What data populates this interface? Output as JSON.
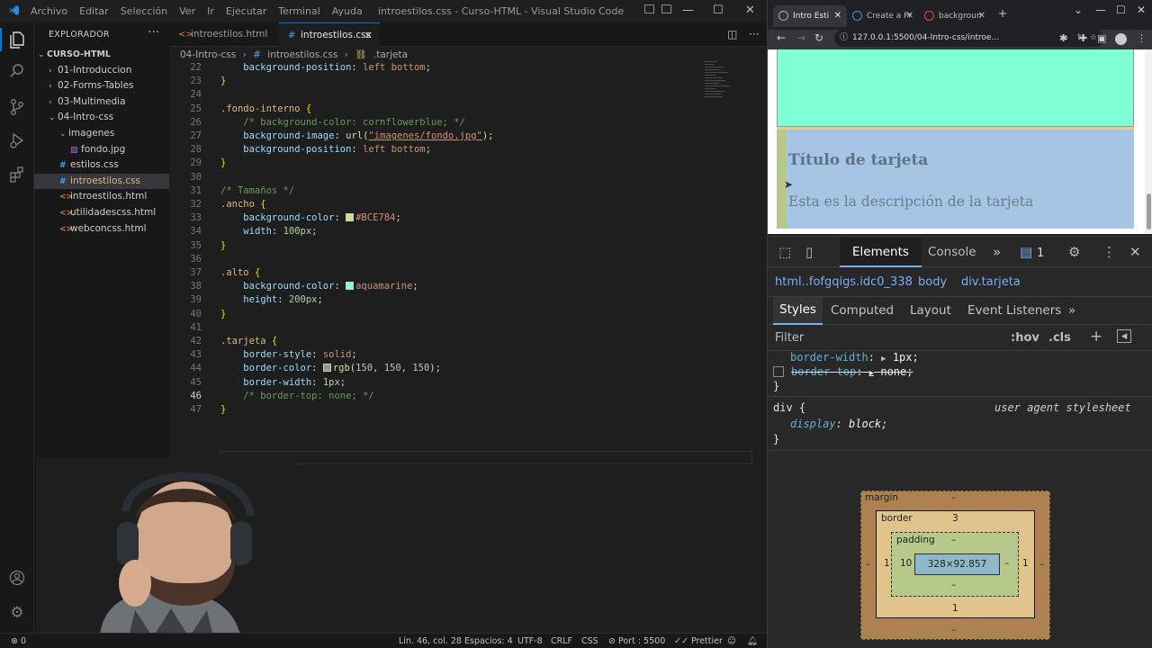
{
  "vscode": {
    "menu": [
      "Archivo",
      "Editar",
      "Selección",
      "Ver",
      "Ir",
      "Ejecutar",
      "Terminal",
      "Ayuda"
    ],
    "window_title": "introestilos.css - Curso-HTML - Visual Studio Code",
    "explorer_title": "EXPLORADOR",
    "tree": [
      {
        "label": "CURSO-HTML",
        "chev": "⌄",
        "type": "root"
      },
      {
        "label": "01-Introduccion",
        "chev": "›",
        "type": "folder"
      },
      {
        "label": "02-Forms-Tables",
        "chev": "›",
        "type": "folder"
      },
      {
        "label": "03-Multimedia",
        "chev": "›",
        "type": "folder"
      },
      {
        "label": "04-Intro-css",
        "chev": "⌄",
        "type": "folder"
      },
      {
        "label": "imagenes",
        "chev": "⌄",
        "type": "folder"
      },
      {
        "label": "fondo.jpg",
        "chev": "",
        "type": "image"
      },
      {
        "label": "estilos.css",
        "chev": "",
        "type": "css"
      },
      {
        "label": "introestilos.css",
        "chev": "",
        "type": "css"
      },
      {
        "label": "introestilos.html",
        "chev": "",
        "type": "html"
      },
      {
        "label": "utilidadescss.html",
        "chev": "",
        "type": "html"
      },
      {
        "label": "webconcss.html",
        "chev": "",
        "type": "html"
      }
    ],
    "tabs": [
      {
        "label": "introestilos.html",
        "icon": "html-icon"
      },
      {
        "label": "introestilos.css",
        "icon": "css-icon"
      }
    ],
    "breadcrumb": [
      "04-Intro-css",
      "#",
      "introestilos.css",
      ".tarjeta"
    ],
    "line_numbers": [
      "22",
      "23",
      "24",
      "25",
      "26",
      "27",
      "28",
      "29",
      "30",
      "31",
      "32",
      "33",
      "34",
      "35",
      "36",
      "37",
      "38",
      "39",
      "40",
      "41",
      "42",
      "43",
      "44",
      "45",
      "46",
      "47"
    ],
    "current_line": "46",
    "status": {
      "errors": "0",
      "position": "Lín. 46, col. 28",
      "spaces": "Espacios: 4",
      "encoding": "UTF-8",
      "eol": "CRLF",
      "language": "CSS",
      "port": "Port : 5500",
      "formatter": "Prettier"
    }
  },
  "code": {
    "l22": [
      "background-position",
      "left bottom"
    ],
    "l25_selector": ".fondo-interno",
    "l26_comment": "/* background-color: cornflowerblue; */",
    "l27": [
      "background-image",
      "url(",
      "\"imagenes/fondo.jpg\"",
      ")"
    ],
    "l28": [
      "background-position",
      "left bottom"
    ],
    "l31_comment": "/* Tamaños */",
    "l32_selector": ".ancho",
    "l33": [
      "background-color",
      "#BCE784"
    ],
    "l34": [
      "width",
      "100px"
    ],
    "l37_selector": ".alto",
    "l38": [
      "background-color",
      "aquamarine"
    ],
    "l39": [
      "height",
      "200px"
    ],
    "l42_selector": ".tarjeta",
    "l43": [
      "border-style",
      "solid"
    ],
    "l44": [
      "border-color",
      "rgb(",
      "150, 150, 150",
      ")"
    ],
    "l45": [
      "border-width",
      "1px"
    ],
    "l46_comment": "/* border-top: none; */",
    "colors": {
      "lime": "#BCE784",
      "aquamarine": "#7fffd4",
      "gray": "#969696"
    }
  },
  "chrome": {
    "tabs": [
      "Intro Estilos",
      "Create a Pr",
      "backgroun"
    ],
    "url": "127.0.0.1:5500/04-Intro-css/introe...",
    "card_title": "Título de tarjeta",
    "card_desc": "Esta es la descripción de la tarjeta"
  },
  "devtools": {
    "tabs": [
      "Elements",
      "Console"
    ],
    "issues_count": "1",
    "crumbs": [
      "html..fofgqigs.idc0_338",
      "body",
      "div.tarjeta"
    ],
    "subtabs": [
      "Styles",
      "Computed",
      "Layout",
      "Event Listeners"
    ],
    "filter_placeholder": "Filter",
    "hov": ":hov",
    "cls": ".cls",
    "rules": {
      "border_width_prop": "border-width",
      "border_width_val": "1px",
      "border_top_prop": "border-top",
      "border_top_val": "none",
      "div_selector": "div {",
      "ua_label": "user agent stylesheet",
      "display_prop": "display",
      "display_val": "block"
    },
    "box_model": {
      "margin_label": "margin",
      "margin_top": "–",
      "margin_left": "–",
      "margin_right": "–",
      "margin_bottom": "–",
      "border_label": "border",
      "border_top": "3",
      "border_left": "1",
      "border_right": "1",
      "border_bottom": "1",
      "padding_label": "padding",
      "padding_top": "–",
      "padding_left": "10",
      "padding_right": "–",
      "padding_bottom": "–",
      "content": "328×92.857"
    }
  }
}
